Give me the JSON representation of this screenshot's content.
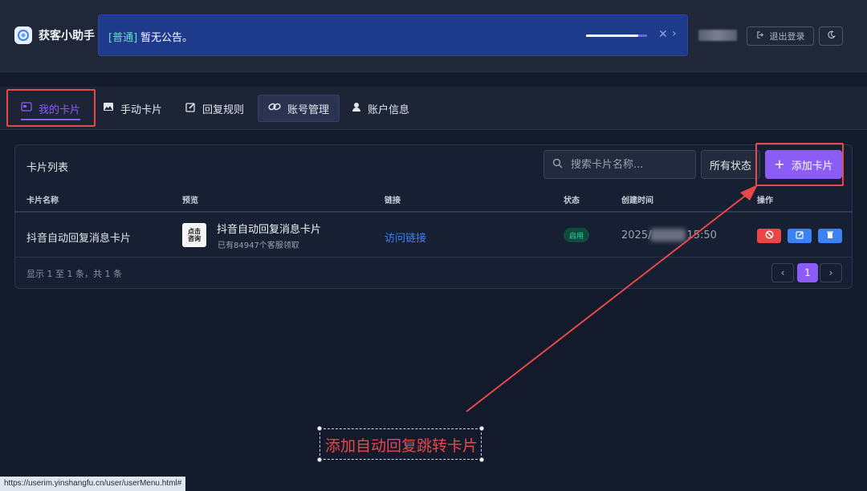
{
  "header": {
    "brand_name": "获客小助手",
    "notice_tag": "[普通]",
    "notice_text": "暂无公告。",
    "notice_progress": 0.85,
    "logout_label": "退出登录"
  },
  "tabs": [
    {
      "label": "我的卡片",
      "active": true
    },
    {
      "label": "手动卡片",
      "active": false
    },
    {
      "label": "回复规则",
      "active": false
    },
    {
      "label": "账号管理",
      "active": false
    },
    {
      "label": "账户信息",
      "active": false
    }
  ],
  "panel": {
    "title": "卡片列表",
    "search_placeholder": "搜索卡片名称...",
    "status_filter": "所有状态",
    "add_label": "添加卡片",
    "columns": [
      "卡片名称",
      "预览",
      "链接",
      "状态",
      "创建时间",
      "操作"
    ],
    "rows": [
      {
        "name": "抖音自动回复消息卡片",
        "thumb_line1": "点击",
        "thumb_line2": "咨询",
        "preview_title": "抖音自动回复消息卡片",
        "preview_sub": "已有84947个客服领取",
        "link": "访问链接",
        "status": "启用",
        "created_prefix": "2025/",
        "created_suffix": "15:50"
      }
    ],
    "footer": "显示 1 至 1 条，共 1 条",
    "current_page": "1"
  },
  "annotation": {
    "text": "添加自动回复跳转卡片"
  },
  "status_bar_url": "https://userim.yinshangfu.cn/user/userMenu.html#",
  "colors": {
    "accent": "#8b5cf6",
    "annotation": "#e74848",
    "link": "#3b82f6",
    "notice_bg": "#1e3a8a"
  }
}
